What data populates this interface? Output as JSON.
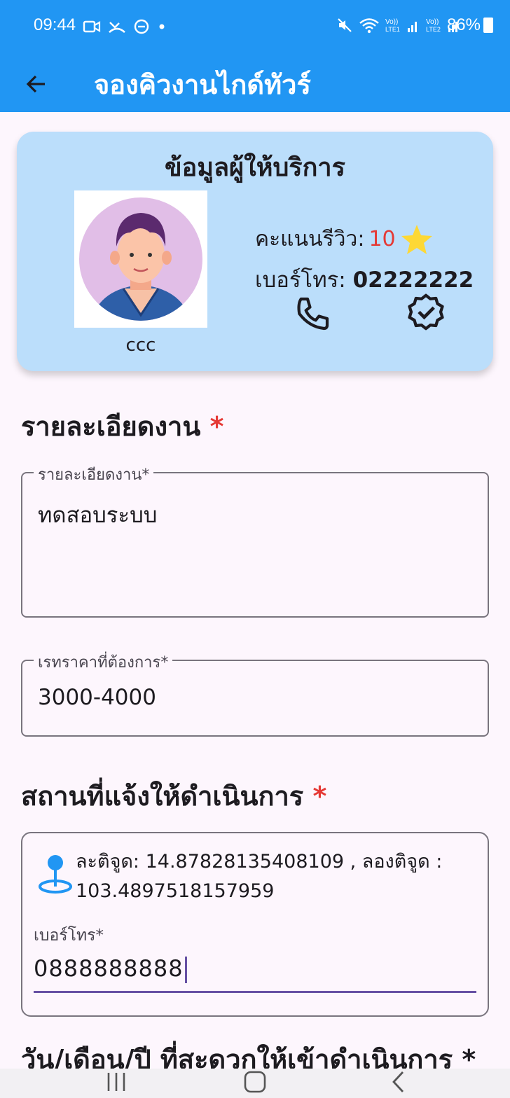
{
  "status_bar": {
    "time": "09:44",
    "battery": "86%",
    "left_icons": [
      "video-icon",
      "call-missed-icon",
      "dnd-icon",
      "dot-icon"
    ],
    "right_icons": [
      "mute-icon",
      "wifi-icon",
      "volte1-icon",
      "volte2-icon"
    ]
  },
  "app_bar": {
    "title": "จองคิวงานไกด์ทัวร์"
  },
  "provider_card": {
    "title": "ข้อมูลผู้ให้บริการ",
    "name": "ccc",
    "review_label": "คะแนนรีวิว:",
    "review_score": "10",
    "phone_label": "เบอร์โทร:",
    "phone_number": "02222222",
    "accent_star": "#fdd835"
  },
  "job_section": {
    "title": "รายละเอียดงาน",
    "required_mark": "*",
    "detail_field": {
      "label": "รายละเอียดงาน*",
      "value": "ทดสอบระบบ"
    },
    "price_field": {
      "label": "เรทราคาที่ต้องการ*",
      "value": "3000-4000"
    }
  },
  "location_section": {
    "title": "สถานที่แจ้งให้ดำเนินการ",
    "required_mark": "*",
    "coords_line1": "ละติจูด: 14.87828135408109 , ลองติจูด :",
    "coords_line2": "103.4897518157959",
    "phone_field": {
      "label": "เบอร์โทร*",
      "value": "0888888888"
    }
  },
  "date_section": {
    "title": "วัน/เดือน/ปี ที่สะดวกให้เข้าดำเนินการ",
    "required_mark": "*"
  },
  "colors": {
    "primary": "#2196f3",
    "card_bg": "#bbdefb",
    "required": "#e53935",
    "focus": "#6750a4"
  }
}
